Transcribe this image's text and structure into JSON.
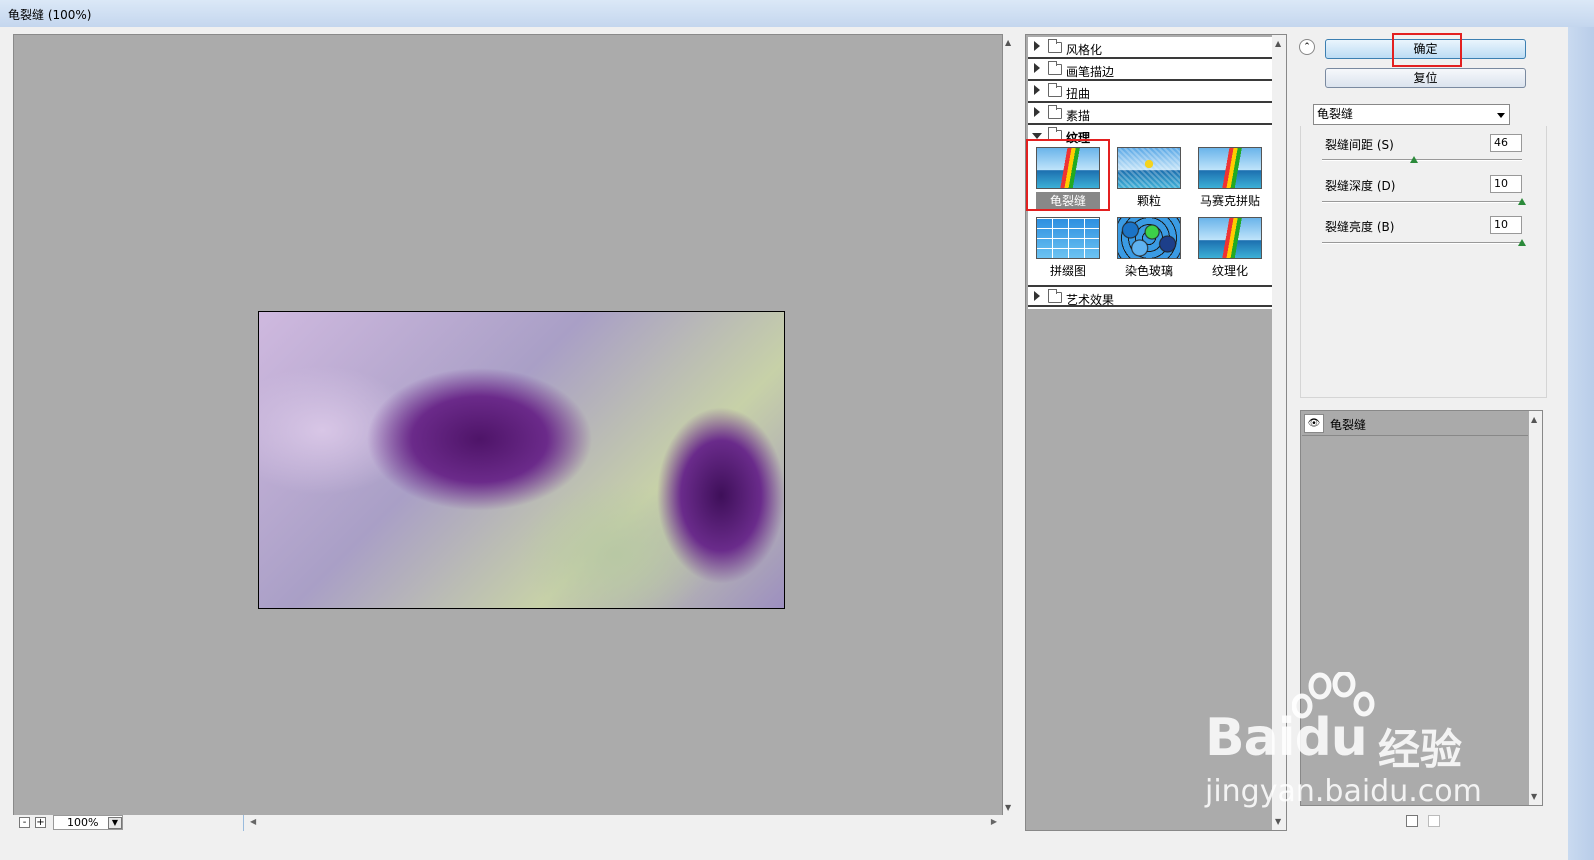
{
  "window": {
    "title": "龟裂缝 (100%)"
  },
  "preview": {
    "image_name": "cracked-flower-preview",
    "zoom_value": "100%",
    "zoom_minus": "-",
    "zoom_plus": "+"
  },
  "filter_gallery": {
    "categories_before": [
      {
        "label": "风格化"
      },
      {
        "label": "画笔描边"
      },
      {
        "label": "扭曲"
      },
      {
        "label": "素描"
      }
    ],
    "expanded_category": {
      "label": "纹理"
    },
    "thumbnails": [
      {
        "label": "龟裂缝",
        "icon": "sailboat-crack",
        "selected": true
      },
      {
        "label": "颗粒",
        "icon": "sailboat-grain"
      },
      {
        "label": "马赛克拼贴",
        "icon": "sailboat-mosaic"
      },
      {
        "label": "拼缀图",
        "icon": "tile-grid"
      },
      {
        "label": "染色玻璃",
        "icon": "stained-glass"
      },
      {
        "label": "纹理化",
        "icon": "sailboat-texture"
      }
    ],
    "categories_after": [
      {
        "label": "艺术效果"
      }
    ]
  },
  "controls": {
    "ok_label": "确定",
    "reset_label": "复位",
    "filter_select_value": "龟裂缝",
    "params": [
      {
        "label": "裂缝间距 (S)",
        "value": "46",
        "fraction": 0.46
      },
      {
        "label": "裂缝深度 (D)",
        "value": "10",
        "fraction": 1.0
      },
      {
        "label": "裂缝亮度 (B)",
        "value": "10",
        "fraction": 1.0
      }
    ]
  },
  "layers": {
    "items": [
      {
        "label": "龟裂缝",
        "visible": true
      }
    ]
  },
  "watermark": {
    "brand": "Bai",
    "brand_suffix": "du",
    "brand_cn": "经验",
    "url": "jingyan.baidu.com"
  },
  "colors": {
    "highlight": "#e32020",
    "slider_thumb": "#2b8a3a",
    "panel_bg": "#ababab"
  }
}
